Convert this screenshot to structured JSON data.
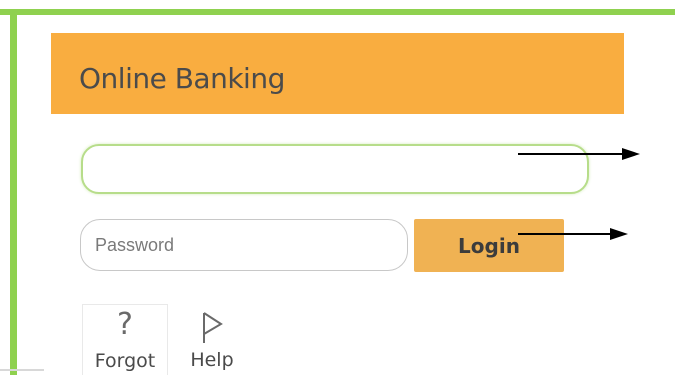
{
  "header": {
    "title": "Online Banking"
  },
  "login_form": {
    "username": {
      "value": "",
      "placeholder": ""
    },
    "password": {
      "value": "",
      "placeholder": "Password"
    },
    "login_label": "Login"
  },
  "links": [
    {
      "label": "Forgot",
      "icon": "question-mark-icon"
    },
    {
      "label": "Help",
      "icon": "flag-icon"
    }
  ],
  "icons": {
    "forgot_glyph": "?"
  },
  "colors": {
    "frame_green": "#8fd14f",
    "header_orange": "#f9ad40",
    "button_orange": "#f0b253",
    "field_focus_green": "#b7dd8a",
    "arrow": "#000000"
  }
}
